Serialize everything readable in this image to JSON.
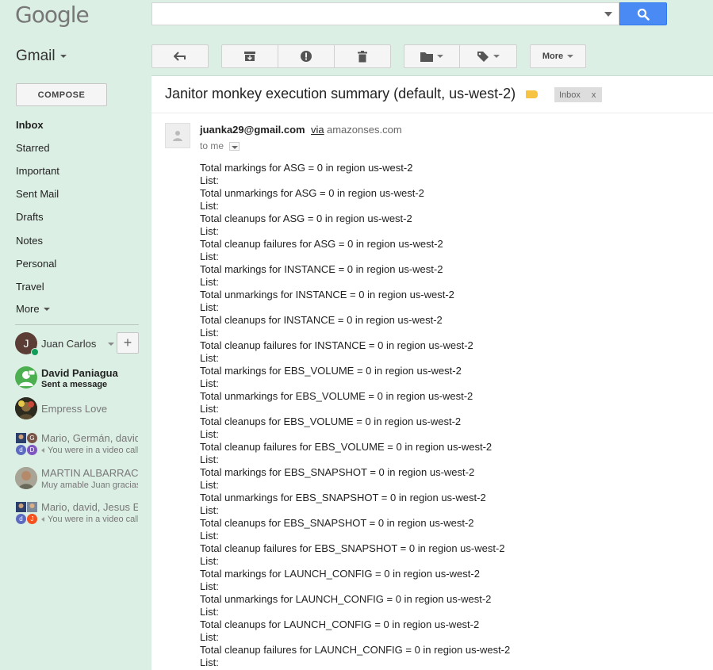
{
  "header": {
    "logo_text": "Google",
    "search_value": "",
    "app_label": "Gmail"
  },
  "toolbar": {
    "reply_icon": "reply-icon",
    "archive_icon": "archive-icon",
    "spam_icon": "report-spam-icon",
    "delete_icon": "trash-icon",
    "move_icon": "folder-icon",
    "labels_icon": "label-icon",
    "more_label": "More"
  },
  "sidebar": {
    "compose_label": "COMPOSE",
    "items": [
      {
        "label": "Inbox",
        "bold": true
      },
      {
        "label": "Starred"
      },
      {
        "label": "Important"
      },
      {
        "label": "Sent Mail"
      },
      {
        "label": "Drafts"
      },
      {
        "label": "Notes"
      },
      {
        "label": "Personal"
      },
      {
        "label": "Travel"
      },
      {
        "label": "More"
      }
    ],
    "account": {
      "initial": "J",
      "name": "Juan Carlos",
      "avatar_color": "#5b3d35"
    },
    "hangouts": [
      {
        "name": "David Paniagua",
        "sub": "Sent a message"
      },
      {
        "name": "Empress Love",
        "sub": ""
      },
      {
        "name": "Mario, Germán, david",
        "sub": "You were in a video call"
      },
      {
        "name": "MARTIN ALBARRACIN",
        "sub": "Muy amable Juan gracias"
      },
      {
        "name": "Mario, david, Jesus E",
        "sub": "You were in a video call"
      }
    ],
    "mini_initials": {
      "g": "G",
      "d1": "d",
      "d2": "D",
      "d3": "d",
      "j": "J"
    }
  },
  "email": {
    "subject": "Janitor monkey execution summary (default, us-west-2)",
    "label_badge": "Inbox",
    "label_close": "x",
    "sender": "juanka29@gmail.com",
    "via": "via",
    "via_domain": "amazonses.com",
    "to": "to me",
    "body_lines": [
      "Total markings for ASG = 0 in region us-west-2",
      "List:",
      "Total unmarkings for ASG = 0 in region us-west-2",
      "List:",
      "Total cleanups for ASG = 0 in region us-west-2",
      "List:",
      "Total cleanup failures for ASG = 0 in region us-west-2",
      "List:",
      "Total markings for INSTANCE = 0 in region us-west-2",
      "List:",
      "Total unmarkings for INSTANCE = 0 in region us-west-2",
      "List:",
      "Total cleanups for INSTANCE = 0 in region us-west-2",
      "List:",
      "Total cleanup failures for INSTANCE = 0 in region us-west-2",
      "List:",
      "Total markings for EBS_VOLUME = 0 in region us-west-2",
      "List:",
      "Total unmarkings for EBS_VOLUME = 0 in region us-west-2",
      "List:",
      "Total cleanups for EBS_VOLUME = 0 in region us-west-2",
      "List:",
      "Total cleanup failures for EBS_VOLUME = 0 in region us-west-2",
      "List:",
      "Total markings for EBS_SNAPSHOT = 0 in region us-west-2",
      "List:",
      "Total unmarkings for EBS_SNAPSHOT = 0 in region us-west-2",
      "List:",
      "Total cleanups for EBS_SNAPSHOT = 0 in region us-west-2",
      "List:",
      "Total cleanup failures for EBS_SNAPSHOT = 0 in region us-west-2",
      "List:",
      "Total markings for LAUNCH_CONFIG = 0 in region us-west-2",
      "List:",
      "Total unmarkings for LAUNCH_CONFIG = 0 in region us-west-2",
      "List:",
      "Total cleanups for LAUNCH_CONFIG = 0 in region us-west-2",
      "List:",
      "Total cleanup failures for LAUNCH_CONFIG = 0 in region us-west-2",
      "List:"
    ]
  },
  "colors": {
    "theme_bg": "#dcefe4",
    "search_button": "#4a8af4",
    "label_yellow": "#f6c342",
    "online": "#0f9d58"
  }
}
